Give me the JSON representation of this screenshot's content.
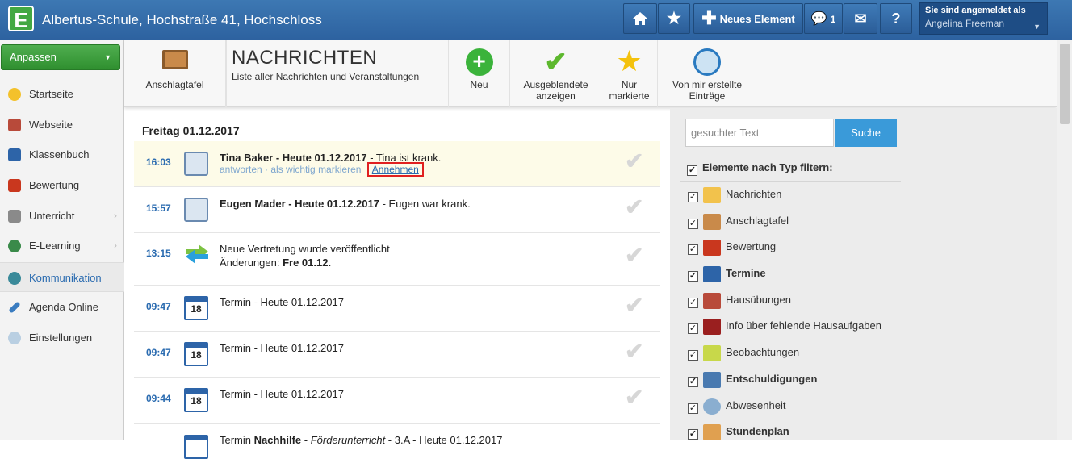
{
  "header": {
    "logo_letter": "E",
    "school": "Albertus-Schule, Hochstraße 41, Hochschloss",
    "new_element_label": "Neues Element",
    "messages_count": "1",
    "help_label": "?",
    "login_label": "Sie sind angemeldet als",
    "user_name": "Angelina Freeman",
    "icons": [
      "home-icon",
      "star-icon",
      "plus-icon",
      "chat-icon",
      "mail-icon",
      "help-icon"
    ]
  },
  "sidebar": {
    "customize_label": "Anpassen",
    "items": [
      {
        "label": "Startseite",
        "icon": "star-icon",
        "color": "#f3c12b"
      },
      {
        "label": "Webseite",
        "icon": "house-icon",
        "color": "#b84a3a"
      },
      {
        "label": "Klassenbuch",
        "icon": "book-icon",
        "color": "#2d64a8"
      },
      {
        "label": "Bewertung",
        "icon": "grade-icon",
        "color": "#c9371e"
      },
      {
        "label": "Unterricht",
        "icon": "teaching-icon",
        "color": "#8a8a8a"
      },
      {
        "label": "E-Learning",
        "icon": "globe-icon",
        "color": "#3a8a4a"
      },
      {
        "label": "Kommunikation",
        "icon": "communication-icon",
        "color": "#3a8a9a"
      },
      {
        "label": "Agenda Online",
        "icon": "pen-icon",
        "color": "#3a7cc0"
      },
      {
        "label": "Einstellungen",
        "icon": "gear-icon",
        "color": "#b9cfe2"
      }
    ]
  },
  "toolbar": {
    "board_label": "Anschlagtafel",
    "title": "Nachrichten",
    "subtitle": "Liste aller Nachrichten und Veranstaltungen",
    "new_label": "Neu",
    "hidden_label_1": "Ausgeblendete",
    "hidden_label_2": "anzeigen",
    "marked_label_1": "Nur",
    "marked_label_2": "markierte",
    "mine_label_1": "Von mir erstellte",
    "mine_label_2": "Einträge"
  },
  "feed": {
    "day": "Freitag 01.12.2017",
    "rows": [
      {
        "time": "16:03",
        "name": "Tina Baker - Heute 01.12.2017",
        "text": " - Tina ist krank.",
        "reply": "antworten",
        "mark": "· als wichtig markieren",
        "accept": "Annehmen"
      },
      {
        "time": "15:57",
        "name": "Eugen Mader - Heute 01.12.2017",
        "text": " - Eugen war krank."
      },
      {
        "time": "13:15",
        "line1": "Neue Vertretung wurde veröffentlicht",
        "line2_prefix": "Änderungen: ",
        "line2_bold": "Fre 01.12."
      },
      {
        "time": "09:47",
        "text": "Termin - Heute 01.12.2017"
      },
      {
        "time": "09:47",
        "text": "Termin - Heute 01.12.2017"
      },
      {
        "time": "09:44",
        "text": "Termin - Heute 01.12.2017"
      },
      {
        "text_prefix": "Termin ",
        "text_bold": "Nachhilfe",
        "text_mid": " - ",
        "text_italic": "Förderunterricht",
        "text_suffix": " - 3.A - Heute 01.12.2017"
      }
    ]
  },
  "filter": {
    "search_placeholder": "gesuchter Text",
    "search_button": "Suche",
    "heading": "Elemente nach Typ filtern:",
    "items": [
      {
        "label": "Nachrichten",
        "icon": "envelope-icon",
        "color": "#f2c24c"
      },
      {
        "label": "Anschlagtafel",
        "icon": "board-icon",
        "color": "#c98a4a"
      },
      {
        "label": "Bewertung",
        "icon": "grade-icon",
        "color": "#c9371e"
      },
      {
        "label": "Termine",
        "icon": "calendar-icon",
        "color": "#2d64a8"
      },
      {
        "label": "Hausübungen",
        "icon": "homework-icon",
        "color": "#b84a3a"
      },
      {
        "label": "Info über fehlende Hausaufgaben",
        "icon": "missing-homework-icon",
        "color": "#9a1f1f"
      },
      {
        "label": "Beobachtungen",
        "icon": "note-icon",
        "color": "#c8d84a"
      },
      {
        "label": "Entschuldigungen",
        "icon": "excuse-icon",
        "color": "#4a7ab0"
      },
      {
        "label": "Abwesenheit",
        "icon": "clock-icon",
        "color": "#8aaed0"
      },
      {
        "label": "Stundenplan",
        "icon": "timetable-icon",
        "color": "#e0a050"
      }
    ]
  }
}
